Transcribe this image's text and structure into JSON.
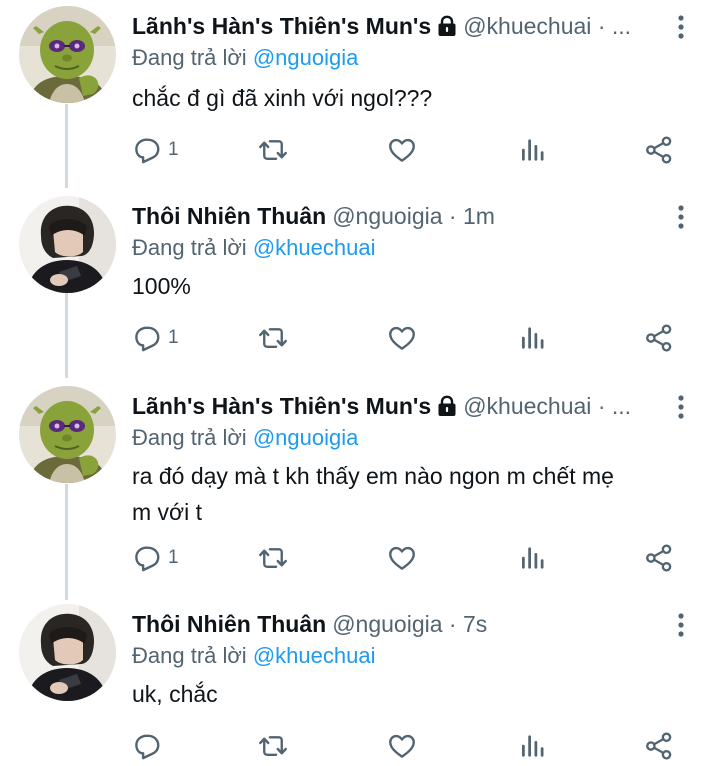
{
  "tweets": [
    {
      "name": "Lãnh's Hàn's Thiên's Mun's",
      "protected": true,
      "handle": "@khuechuai",
      "dot": "·",
      "time": "...",
      "reply_prefix": "Đang trả lời",
      "reply_to": "@nguoigia",
      "text": "chắc đ gì đã xinh với ngol???",
      "reply_count": "1",
      "avatar": "shrek-avatar"
    },
    {
      "name": "Thôi Nhiên Thuân",
      "protected": false,
      "handle": "@nguoigia",
      "dot": "·",
      "time": "1m",
      "reply_prefix": "Đang trả lời",
      "reply_to": "@khuechuai",
      "text": "100%",
      "reply_count": "1",
      "avatar": "person-avatar"
    },
    {
      "name": "Lãnh's Hàn's Thiên's Mun's",
      "protected": true,
      "handle": "@khuechuai",
      "dot": "·",
      "time": "...",
      "reply_prefix": "Đang trả lời",
      "reply_to": "@nguoigia",
      "text_line1": "ra đó dạy mà t kh thấy em nào ngon m chết mẹ",
      "text_line2": "m với t",
      "reply_count": "1",
      "avatar": "shrek-avatar"
    },
    {
      "name": "Thôi Nhiên Thuân",
      "protected": false,
      "handle": "@nguoigia",
      "dot": "·",
      "time": "7s",
      "reply_prefix": "Đang trả lời",
      "reply_to": "@khuechuai",
      "text": "uk, chắc",
      "reply_count": "",
      "avatar": "person-avatar"
    }
  ],
  "icons": {
    "reply": "reply-icon",
    "retweet": "retweet-icon",
    "like": "like-icon",
    "views": "views-icon",
    "share": "share-icon",
    "more": "more-vertical-icon",
    "lock": "lock-icon"
  },
  "colors": {
    "mention": "#1d9bf0",
    "secondary_text": "#536471",
    "thread_line": "#cfd9de"
  }
}
